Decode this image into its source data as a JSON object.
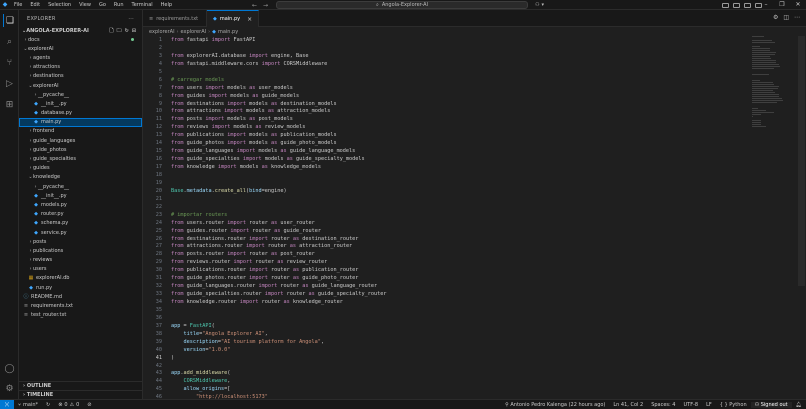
{
  "titlebar": {
    "menu": [
      "File",
      "Edit",
      "Selection",
      "View",
      "Go",
      "Run",
      "Terminal",
      "Help"
    ],
    "search": "Angola-Explorer-AI"
  },
  "sidebar": {
    "header": "EXPLORER",
    "header_more": "···",
    "project": "ANGOLA-EXPLORER-AI",
    "items": [
      {
        "label": "docs",
        "type": "folder",
        "depth": 1,
        "open": false,
        "badge": "dot"
      },
      {
        "label": "explorerAI",
        "type": "folder",
        "depth": 1,
        "open": true
      },
      {
        "label": "agents",
        "type": "folder",
        "depth": 2,
        "open": false
      },
      {
        "label": "attractions",
        "type": "folder",
        "depth": 2,
        "open": false
      },
      {
        "label": "destinations",
        "type": "folder",
        "depth": 2,
        "open": false
      },
      {
        "label": "explorerAI",
        "type": "folder",
        "depth": 2,
        "open": true
      },
      {
        "label": "__pycache__",
        "type": "folder",
        "depth": 3,
        "open": false
      },
      {
        "label": "__init__.py",
        "type": "py",
        "depth": 3
      },
      {
        "label": "database.py",
        "type": "py",
        "depth": 3
      },
      {
        "label": "main.py",
        "type": "py",
        "depth": 3,
        "selected": true
      },
      {
        "label": "frontend",
        "type": "folder",
        "depth": 2,
        "open": false
      },
      {
        "label": "guide_languages",
        "type": "folder",
        "depth": 2,
        "open": false
      },
      {
        "label": "guide_photos",
        "type": "folder",
        "depth": 2,
        "open": false
      },
      {
        "label": "guide_specialties",
        "type": "folder",
        "depth": 2,
        "open": false
      },
      {
        "label": "guides",
        "type": "folder",
        "depth": 2,
        "open": false
      },
      {
        "label": "knowledge",
        "type": "folder",
        "depth": 2,
        "open": true
      },
      {
        "label": "__pycache__",
        "type": "folder",
        "depth": 3,
        "open": false
      },
      {
        "label": "__init__.py",
        "type": "py",
        "depth": 3
      },
      {
        "label": "models.py",
        "type": "py",
        "depth": 3
      },
      {
        "label": "router.py",
        "type": "py",
        "depth": 3
      },
      {
        "label": "schema.py",
        "type": "py",
        "depth": 3
      },
      {
        "label": "service.py",
        "type": "py",
        "depth": 3
      },
      {
        "label": "posts",
        "type": "folder",
        "depth": 2,
        "open": false
      },
      {
        "label": "publications",
        "type": "folder",
        "depth": 2,
        "open": false
      },
      {
        "label": "reviews",
        "type": "folder",
        "depth": 2,
        "open": false
      },
      {
        "label": "users",
        "type": "folder",
        "depth": 2,
        "open": false
      },
      {
        "label": "explorerAI.db",
        "type": "db",
        "depth": 2
      },
      {
        "label": "run.py",
        "type": "py",
        "depth": 2
      },
      {
        "label": "README.md",
        "type": "md",
        "depth": 1
      },
      {
        "label": "requirements.txt",
        "type": "txt",
        "depth": 1
      },
      {
        "label": "test_router.txt",
        "type": "txt",
        "depth": 1
      }
    ],
    "outline": "OUTLINE",
    "timeline": "TIMELINE"
  },
  "tabs": [
    {
      "label": "requirements.txt",
      "active": false
    },
    {
      "label": "main.py",
      "active": true
    }
  ],
  "breadcrumb": [
    "explorerAI",
    "explorerAI",
    "main.py"
  ],
  "code": [
    {
      "n": "1",
      "t": [
        [
          "kw",
          "from"
        ],
        [
          "txt",
          " fastapi "
        ],
        [
          "kw",
          "import"
        ],
        [
          "txt",
          " FastAPI"
        ]
      ]
    },
    {
      "n": "2",
      "t": []
    },
    {
      "n": "3",
      "t": [
        [
          "kw",
          "from"
        ],
        [
          "txt",
          " explorerAI.database "
        ],
        [
          "kw",
          "import"
        ],
        [
          "txt",
          " engine, Base"
        ]
      ]
    },
    {
      "n": "4",
      "t": [
        [
          "kw",
          "from"
        ],
        [
          "txt",
          " fastapi.middleware.cors "
        ],
        [
          "kw",
          "import"
        ],
        [
          "txt",
          " CORSMiddleware"
        ]
      ]
    },
    {
      "n": "5",
      "t": []
    },
    {
      "n": "6",
      "t": [
        [
          "cm",
          "# carregar models"
        ]
      ]
    },
    {
      "n": "7",
      "t": [
        [
          "kw",
          "from"
        ],
        [
          "txt",
          " users "
        ],
        [
          "kw",
          "import"
        ],
        [
          "txt",
          " models "
        ],
        [
          "kw",
          "as"
        ],
        [
          "txt",
          " user_models"
        ]
      ]
    },
    {
      "n": "8",
      "t": [
        [
          "kw",
          "from"
        ],
        [
          "txt",
          " guides "
        ],
        [
          "kw",
          "import"
        ],
        [
          "txt",
          " models "
        ],
        [
          "kw",
          "as"
        ],
        [
          "txt",
          " guide_models"
        ]
      ]
    },
    {
      "n": "9",
      "t": [
        [
          "kw",
          "from"
        ],
        [
          "txt",
          " destinations "
        ],
        [
          "kw",
          "import"
        ],
        [
          "txt",
          " models "
        ],
        [
          "kw",
          "as"
        ],
        [
          "txt",
          " destination_models"
        ]
      ]
    },
    {
      "n": "10",
      "t": [
        [
          "kw",
          "from"
        ],
        [
          "txt",
          " attractions "
        ],
        [
          "kw",
          "import"
        ],
        [
          "txt",
          " models "
        ],
        [
          "kw",
          "as"
        ],
        [
          "txt",
          " attraction_models"
        ]
      ]
    },
    {
      "n": "11",
      "t": [
        [
          "kw",
          "from"
        ],
        [
          "txt",
          " posts "
        ],
        [
          "kw",
          "import"
        ],
        [
          "txt",
          " models "
        ],
        [
          "kw",
          "as"
        ],
        [
          "txt",
          " post_models"
        ]
      ]
    },
    {
      "n": "12",
      "t": [
        [
          "kw",
          "from"
        ],
        [
          "txt",
          " reviews "
        ],
        [
          "kw",
          "import"
        ],
        [
          "txt",
          " models "
        ],
        [
          "kw",
          "as"
        ],
        [
          "txt",
          " review_models"
        ]
      ]
    },
    {
      "n": "13",
      "t": [
        [
          "kw",
          "from"
        ],
        [
          "txt",
          " publications "
        ],
        [
          "kw",
          "import"
        ],
        [
          "txt",
          " models "
        ],
        [
          "kw",
          "as"
        ],
        [
          "txt",
          " publication_models"
        ]
      ]
    },
    {
      "n": "14",
      "t": [
        [
          "kw",
          "from"
        ],
        [
          "txt",
          " guide_photos "
        ],
        [
          "kw",
          "import"
        ],
        [
          "txt",
          " models "
        ],
        [
          "kw",
          "as"
        ],
        [
          "txt",
          " guide_photo_models"
        ]
      ]
    },
    {
      "n": "15",
      "t": [
        [
          "kw",
          "from"
        ],
        [
          "txt",
          " guide_languages "
        ],
        [
          "kw",
          "import"
        ],
        [
          "txt",
          " models "
        ],
        [
          "kw",
          "as"
        ],
        [
          "txt",
          " guide_language_models"
        ]
      ]
    },
    {
      "n": "16",
      "t": [
        [
          "kw",
          "from"
        ],
        [
          "txt",
          " guide_specialties "
        ],
        [
          "kw",
          "import"
        ],
        [
          "txt",
          " models "
        ],
        [
          "kw",
          "as"
        ],
        [
          "txt",
          " guide_specialty_models"
        ]
      ]
    },
    {
      "n": "17",
      "t": [
        [
          "kw",
          "from"
        ],
        [
          "txt",
          " knowledge "
        ],
        [
          "kw",
          "import"
        ],
        [
          "txt",
          " models "
        ],
        [
          "kw",
          "as"
        ],
        [
          "txt",
          " knowledge_models"
        ]
      ]
    },
    {
      "n": "18",
      "t": []
    },
    {
      "n": "19",
      "t": []
    },
    {
      "n": "20",
      "t": [
        [
          "cls",
          "Base"
        ],
        [
          "txt",
          "."
        ],
        [
          "vr",
          "metadata"
        ],
        [
          "txt",
          "."
        ],
        [
          "fn",
          "create_all"
        ],
        [
          "txt",
          "("
        ],
        [
          "vr",
          "bind"
        ],
        [
          "txt",
          "=engine)"
        ]
      ]
    },
    {
      "n": "21",
      "t": []
    },
    {
      "n": "22",
      "t": []
    },
    {
      "n": "23",
      "t": [
        [
          "cm",
          "# importar routers"
        ]
      ]
    },
    {
      "n": "24",
      "t": [
        [
          "kw",
          "from"
        ],
        [
          "txt",
          " users.router "
        ],
        [
          "kw",
          "import"
        ],
        [
          "txt",
          " router "
        ],
        [
          "kw",
          "as"
        ],
        [
          "txt",
          " user_router"
        ]
      ]
    },
    {
      "n": "25",
      "t": [
        [
          "kw",
          "from"
        ],
        [
          "txt",
          " guides.router "
        ],
        [
          "kw",
          "import"
        ],
        [
          "txt",
          " router "
        ],
        [
          "kw",
          "as"
        ],
        [
          "txt",
          " guide_router"
        ]
      ]
    },
    {
      "n": "26",
      "t": [
        [
          "kw",
          "from"
        ],
        [
          "txt",
          " destinations.router "
        ],
        [
          "kw",
          "import"
        ],
        [
          "txt",
          " router "
        ],
        [
          "kw",
          "as"
        ],
        [
          "txt",
          " destination_router"
        ]
      ]
    },
    {
      "n": "27",
      "t": [
        [
          "kw",
          "from"
        ],
        [
          "txt",
          " attractions.router "
        ],
        [
          "kw",
          "import"
        ],
        [
          "txt",
          " router "
        ],
        [
          "kw",
          "as"
        ],
        [
          "txt",
          " attraction_router"
        ]
      ]
    },
    {
      "n": "28",
      "t": [
        [
          "kw",
          "from"
        ],
        [
          "txt",
          " posts.router "
        ],
        [
          "kw",
          "import"
        ],
        [
          "txt",
          " router "
        ],
        [
          "kw",
          "as"
        ],
        [
          "txt",
          " post_router"
        ]
      ]
    },
    {
      "n": "29",
      "t": [
        [
          "kw",
          "from"
        ],
        [
          "txt",
          " reviews.router "
        ],
        [
          "kw",
          "import"
        ],
        [
          "txt",
          " router "
        ],
        [
          "kw",
          "as"
        ],
        [
          "txt",
          " review_router"
        ]
      ]
    },
    {
      "n": "30",
      "t": [
        [
          "kw",
          "from"
        ],
        [
          "txt",
          " publications.router "
        ],
        [
          "kw",
          "import"
        ],
        [
          "txt",
          " router "
        ],
        [
          "kw",
          "as"
        ],
        [
          "txt",
          " publication_router"
        ]
      ]
    },
    {
      "n": "31",
      "t": [
        [
          "kw",
          "from"
        ],
        [
          "txt",
          " guide_photos.router "
        ],
        [
          "kw",
          "import"
        ],
        [
          "txt",
          " router "
        ],
        [
          "kw",
          "as"
        ],
        [
          "txt",
          " guide_photo_router"
        ]
      ]
    },
    {
      "n": "32",
      "t": [
        [
          "kw",
          "from"
        ],
        [
          "txt",
          " guide_languages.router "
        ],
        [
          "kw",
          "import"
        ],
        [
          "txt",
          " router "
        ],
        [
          "kw",
          "as"
        ],
        [
          "txt",
          " guide_language_router"
        ]
      ]
    },
    {
      "n": "33",
      "t": [
        [
          "kw",
          "from"
        ],
        [
          "txt",
          " guide_specialties.router "
        ],
        [
          "kw",
          "import"
        ],
        [
          "txt",
          " router "
        ],
        [
          "kw",
          "as"
        ],
        [
          "txt",
          " guide_specialty_router"
        ]
      ]
    },
    {
      "n": "34",
      "t": [
        [
          "kw",
          "from"
        ],
        [
          "txt",
          " knowledge.router "
        ],
        [
          "kw",
          "import"
        ],
        [
          "txt",
          " router "
        ],
        [
          "kw",
          "as"
        ],
        [
          "txt",
          " knowledge_router"
        ]
      ]
    },
    {
      "n": "35",
      "t": []
    },
    {
      "n": "36",
      "t": []
    },
    {
      "n": "37",
      "t": [
        [
          "vr",
          "app"
        ],
        [
          "txt",
          " = "
        ],
        [
          "cls",
          "FastAPI"
        ],
        [
          "txt",
          "("
        ]
      ]
    },
    {
      "n": "38",
      "t": [
        [
          "txt",
          "    "
        ],
        [
          "vr",
          "title"
        ],
        [
          "txt",
          "="
        ],
        [
          "str",
          "\"Angola Explorer AI\""
        ],
        [
          "txt",
          ","
        ]
      ]
    },
    {
      "n": "39",
      "t": [
        [
          "txt",
          "    "
        ],
        [
          "vr",
          "description"
        ],
        [
          "txt",
          "="
        ],
        [
          "str",
          "\"AI tourism platform for Angola\""
        ],
        [
          "txt",
          ","
        ]
      ]
    },
    {
      "n": "40",
      "t": [
        [
          "txt",
          "    "
        ],
        [
          "vr",
          "version"
        ],
        [
          "txt",
          "="
        ],
        [
          "str",
          "\"1.0.0\""
        ]
      ]
    },
    {
      "n": "41",
      "t": [
        [
          "txt",
          ")"
        ]
      ],
      "current": true
    },
    {
      "n": "42",
      "t": []
    },
    {
      "n": "43",
      "t": [
        [
          "vr",
          "app"
        ],
        [
          "txt",
          "."
        ],
        [
          "fn",
          "add_middleware"
        ],
        [
          "txt",
          "("
        ]
      ]
    },
    {
      "n": "44",
      "t": [
        [
          "txt",
          "    "
        ],
        [
          "cls",
          "CORSMiddleware"
        ],
        [
          "txt",
          ","
        ]
      ]
    },
    {
      "n": "45",
      "t": [
        [
          "txt",
          "    "
        ],
        [
          "vr",
          "allow_origins"
        ],
        [
          "txt",
          "=["
        ]
      ]
    },
    {
      "n": "46",
      "t": [
        [
          "txt",
          "        "
        ],
        [
          "str",
          "\"http://localhost:5173\""
        ]
      ]
    }
  ],
  "statusbar": {
    "branch": "main*",
    "errors": "0",
    "warnings": "0",
    "blame": "Antonio Pedro Kalenga (22 hours ago)",
    "position": "Ln 41, Col 2",
    "spaces": "Spaces: 4",
    "encoding": "UTF-8",
    "eol": "LF",
    "language": "Python",
    "account": "Signed out"
  }
}
